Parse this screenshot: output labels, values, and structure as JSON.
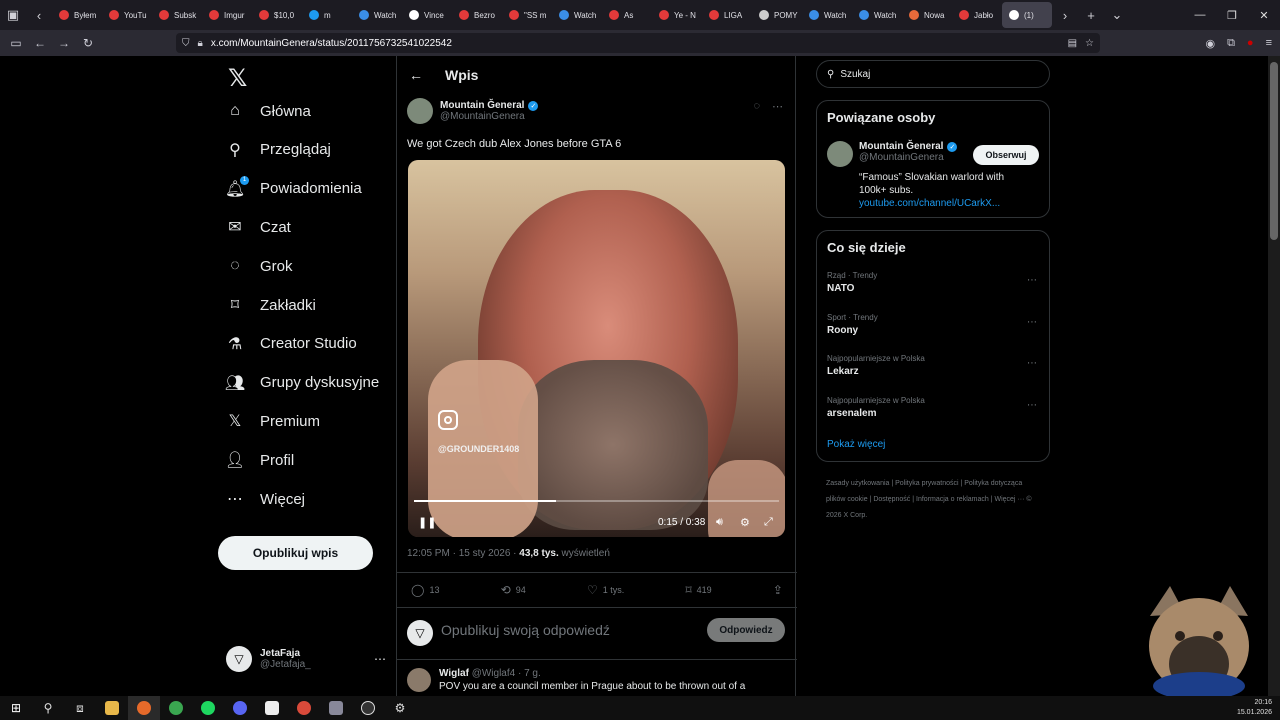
{
  "browser": {
    "tabs": [
      {
        "label": "Byłem",
        "color": "#e23a3a"
      },
      {
        "label": "YouTu",
        "color": "#e23a3a"
      },
      {
        "label": "Subsk",
        "color": "#e23a3a"
      },
      {
        "label": "Imgur",
        "color": "#e23a3a"
      },
      {
        "label": "$10,0",
        "color": "#e23a3a"
      },
      {
        "label": "m",
        "color": "#1d9bf0"
      },
      {
        "label": "Watch",
        "color": "#3a8ee6"
      },
      {
        "label": "Vince",
        "color": "#ffffff"
      },
      {
        "label": "Bezro",
        "color": "#e23a3a"
      },
      {
        "label": "\"SS m",
        "color": "#e23a3a"
      },
      {
        "label": "Watch",
        "color": "#3a8ee6"
      },
      {
        "label": "As",
        "color": "#e23a3a"
      },
      {
        "label": "Ye - N",
        "color": "#e23a3a"
      },
      {
        "label": "LIGA",
        "color": "#e23a3a"
      },
      {
        "label": "POMY",
        "color": "#cccccc"
      },
      {
        "label": "Watch",
        "color": "#3a8ee6"
      },
      {
        "label": "Watch",
        "color": "#3a8ee6"
      },
      {
        "label": "Nowa",
        "color": "#e86a3a"
      },
      {
        "label": "Jabło",
        "color": "#e23a3a"
      },
      {
        "label": "(1)",
        "color": "#ffffff"
      }
    ],
    "url": "x.com/MountainGenera/status/2011756732541022542"
  },
  "nav": {
    "items": [
      {
        "label": "Główna",
        "icon": "home-icon",
        "glyph": "⌂"
      },
      {
        "label": "Przeglądaj",
        "icon": "search-icon",
        "glyph": "⚲"
      },
      {
        "label": "Powiadomienia",
        "icon": "bell-icon",
        "glyph": "🔔︎",
        "badge": "1"
      },
      {
        "label": "Czat",
        "icon": "mail-icon",
        "glyph": "✉"
      },
      {
        "label": "Grok",
        "icon": "grok-icon",
        "glyph": "◌"
      },
      {
        "label": "Zakładki",
        "icon": "bookmark-icon",
        "glyph": "⌑"
      },
      {
        "label": "Creator Studio",
        "icon": "flask-icon",
        "glyph": "⚗"
      },
      {
        "label": "Grupy dyskusyjne",
        "icon": "people-icon",
        "glyph": "👥︎"
      },
      {
        "label": "Premium",
        "icon": "x-icon",
        "glyph": "𝕏"
      },
      {
        "label": "Profil",
        "icon": "person-icon",
        "glyph": "👤︎"
      },
      {
        "label": "Więcej",
        "icon": "more-icon",
        "glyph": "⋯"
      }
    ],
    "post_button": "Opublikuj wpis",
    "user": {
      "name": "JetaFaja",
      "handle": "@Jetafaja_"
    }
  },
  "post": {
    "header": "Wpis",
    "author": "Mountain Ğeneral",
    "handle": "@MountainGenera",
    "text": "We got Czech dub Alex Jones before GTA 6",
    "video": {
      "watermark": "@GROUNDER1408",
      "time": "0:15 / 0:38",
      "progress": 0.39
    },
    "timestamp": "12:05 PM · 15 sty 2026 · ",
    "views": "43,8 tys.",
    "views_label": " wyświetleń",
    "stats": {
      "replies": "13",
      "reposts": "94",
      "likes": "1 tys.",
      "bookmarks": "419"
    },
    "reply_placeholder": "Opublikuj swoją odpowiedź",
    "reply_button": "Odpowiedz"
  },
  "next_reply": {
    "author": "Wiglaf",
    "handle": "@Wiglaf4 · 7 g.",
    "text": "POV you are a council member in Prague about to be thrown out of a"
  },
  "sidebar": {
    "search_placeholder": "Szukaj",
    "related_title": "Powiązane osoby",
    "related": {
      "name": "Mountain Ğeneral",
      "handle": "@MountainGenera",
      "follow": "Obserwuj",
      "bio": "“Famous” Slovakian warlord with 100k+ subs.",
      "link": "youtube.com/channel/UCarkX..."
    },
    "trends_title": "Co się dzieje",
    "trends": [
      {
        "category": "Rząd · Trendy",
        "name": "NATO"
      },
      {
        "category": "Sport · Trendy",
        "name": "Roony"
      },
      {
        "category": "Najpopularniejsze w Polska",
        "name": "Lekarz"
      },
      {
        "category": "Najpopularniejsze w Polska",
        "name": "arsenalem"
      }
    ],
    "show_more": "Pokaż więcej",
    "footer": "Zasady użytkowania  |  Polityka prywatności  |  Polityka dotycząca plików cookie  |  Dostępność  |  Informacja o reklamach  |  Więcej ···  © 2026 X Corp."
  },
  "taskbar": {
    "time": "20:16",
    "date": "15.01.2026"
  }
}
